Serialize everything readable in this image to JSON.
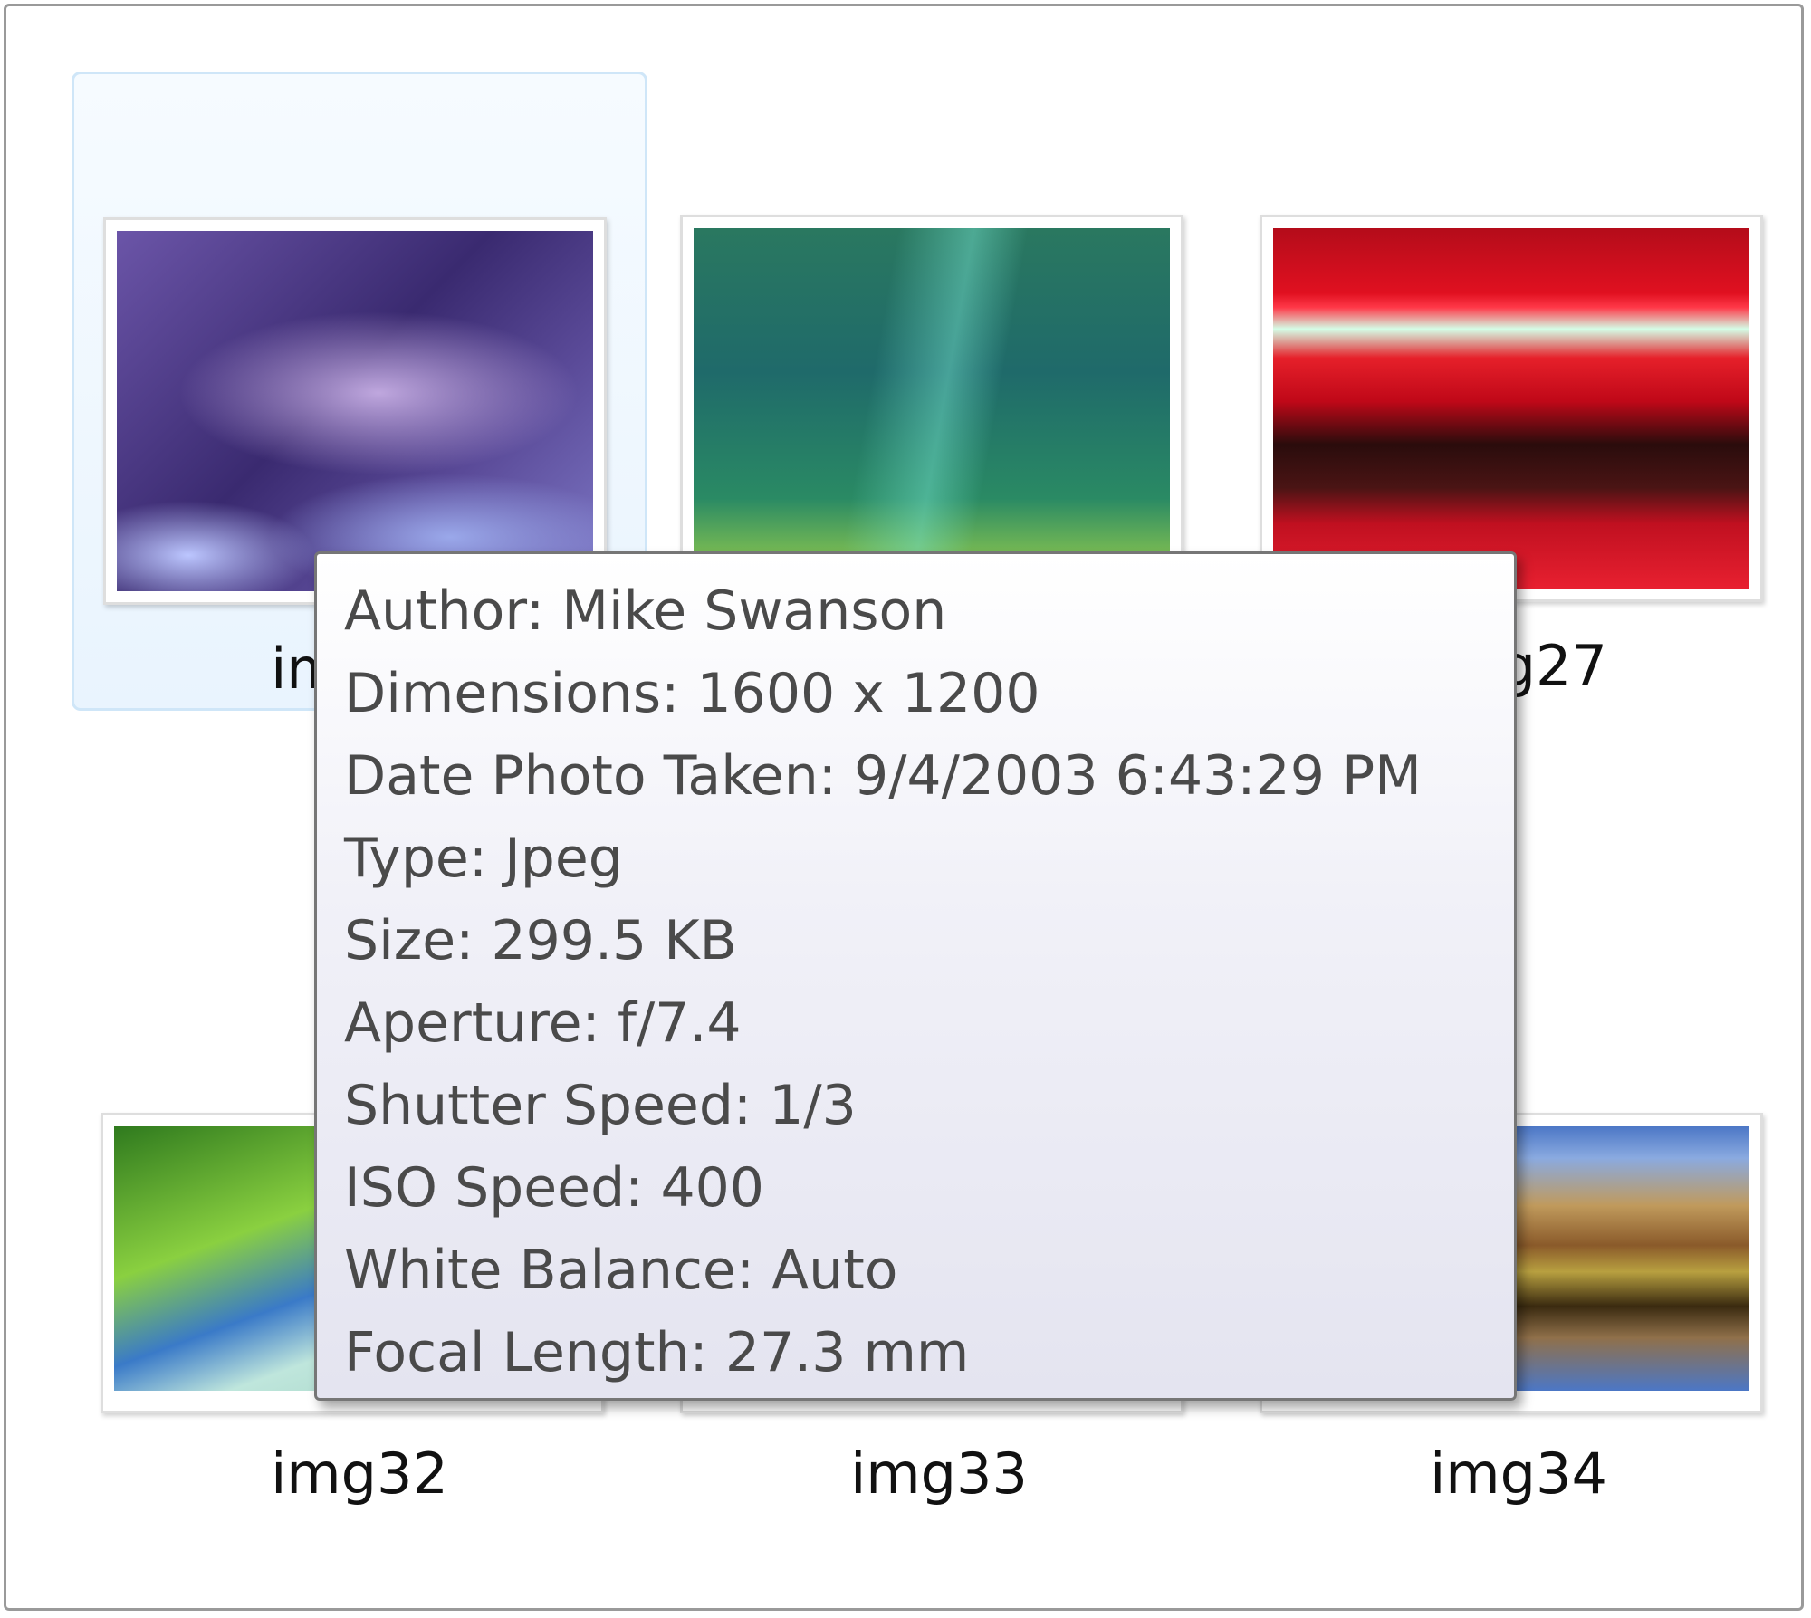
{
  "items": [
    {
      "label": "img26",
      "thumb": "purple-abstract"
    },
    {
      "label": "",
      "thumb": "green-aurora"
    },
    {
      "label": "img27",
      "thumb": "red-streaks"
    },
    {
      "label": "img32",
      "thumb": "leaf-and-sea"
    },
    {
      "label": "img33",
      "thumb": "hidden"
    },
    {
      "label": "img34",
      "thumb": "mountain-reflection"
    }
  ],
  "tooltip": {
    "lines": [
      "Author: Mike Swanson",
      "Dimensions: 1600 x 1200",
      "Date Photo Taken: 9/4/2003 6:43:29 PM",
      "Type: Jpeg",
      "Size: 299.5 KB",
      "Aperture: f/7.4",
      "Shutter Speed: 1/3",
      "ISO Speed: 400",
      "White Balance: Auto",
      "Focal Length: 27.3 mm"
    ]
  },
  "colors": {
    "selection_fill": "#eaf4fd",
    "selection_border": "#cfe6f8",
    "tooltip_border": "#767676",
    "tooltip_text": "#4a4a4a"
  }
}
